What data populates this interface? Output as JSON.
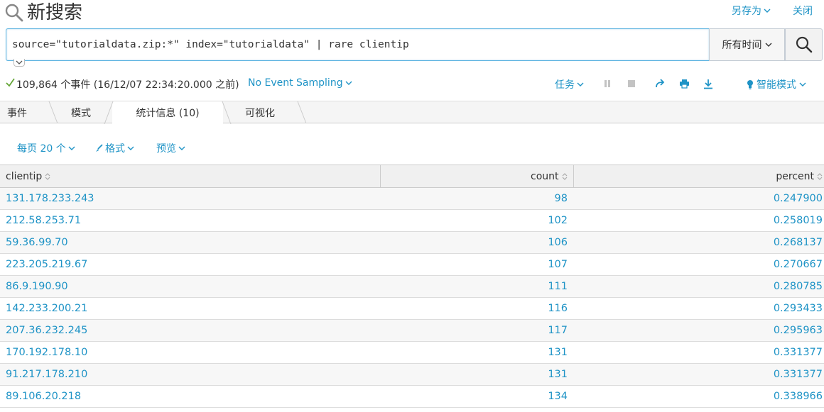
{
  "header": {
    "title": "新搜索",
    "save_as_label": "另存为",
    "close_label": "关闭"
  },
  "search": {
    "query": "source=\"tutorialdata.zip:*\" index=\"tutorialdata\" | rare clientip",
    "time_range": "所有时间"
  },
  "status": {
    "event_summary": "109,864 个事件 (16/12/07 22:34:20.000 之前)",
    "sampling_label": "No Event Sampling",
    "job_label": "任务",
    "mode_label": "智能模式"
  },
  "tabs": [
    {
      "label": "事件",
      "active": false
    },
    {
      "label": "模式",
      "active": false
    },
    {
      "label": "统计信息 (10)",
      "active": true
    },
    {
      "label": "可视化",
      "active": false
    }
  ],
  "table_toolbar": {
    "per_page_label": "每页 20 个",
    "format_label": "格式",
    "preview_label": "预览"
  },
  "table": {
    "columns": [
      "clientip",
      "count",
      "percent"
    ],
    "rows": [
      [
        "131.178.233.243",
        "98",
        "0.247900"
      ],
      [
        "212.58.253.71",
        "102",
        "0.258019"
      ],
      [
        "59.36.99.70",
        "106",
        "0.268137"
      ],
      [
        "223.205.219.67",
        "107",
        "0.270667"
      ],
      [
        "86.9.190.90",
        "111",
        "0.280785"
      ],
      [
        "142.233.200.21",
        "116",
        "0.293433"
      ],
      [
        "207.36.232.245",
        "117",
        "0.295963"
      ],
      [
        "170.192.178.10",
        "131",
        "0.331377"
      ],
      [
        "91.217.178.210",
        "131",
        "0.331377"
      ],
      [
        "89.106.20.218",
        "134",
        "0.338966"
      ]
    ]
  },
  "colors": {
    "link": "#1e93c6",
    "success": "#65a637",
    "focus_border": "#5bb2e0"
  }
}
